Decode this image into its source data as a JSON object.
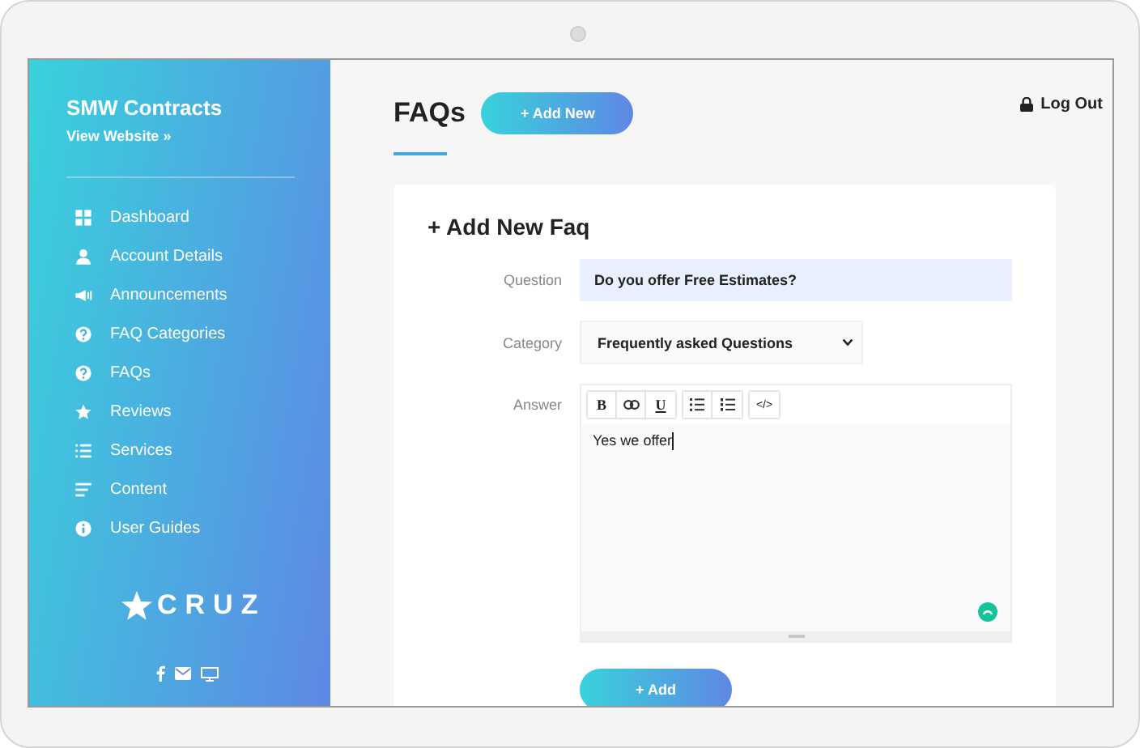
{
  "sidebar": {
    "title": "SMW Contracts",
    "link": "View Website »",
    "items": [
      {
        "label": "Dashboard"
      },
      {
        "label": "Account Details"
      },
      {
        "label": "Announcements"
      },
      {
        "label": "FAQ Categories"
      },
      {
        "label": "FAQs"
      },
      {
        "label": "Reviews"
      },
      {
        "label": "Services"
      },
      {
        "label": "Content"
      },
      {
        "label": "User Guides"
      }
    ],
    "logo": "CRUZ"
  },
  "header": {
    "title": "FAQs",
    "add_button": "+ Add New",
    "logout": "Log Out"
  },
  "form": {
    "title": "+ Add New Faq",
    "question": {
      "label": "Question",
      "value": "Do you offer Free Estimates?"
    },
    "category": {
      "label": "Category",
      "value": "Frequently asked Questions"
    },
    "answer": {
      "label": "Answer",
      "value": "Yes we offer",
      "toolbar": [
        [
          {
            "kind": "text",
            "text": "B"
          },
          {
            "kind": "link"
          },
          {
            "kind": "underline",
            "text": "U"
          }
        ],
        [
          {
            "kind": "bullets"
          },
          {
            "kind": "numbers"
          }
        ],
        [
          {
            "kind": "text",
            "text": "</>"
          }
        ]
      ]
    },
    "submit": "+ Add"
  }
}
